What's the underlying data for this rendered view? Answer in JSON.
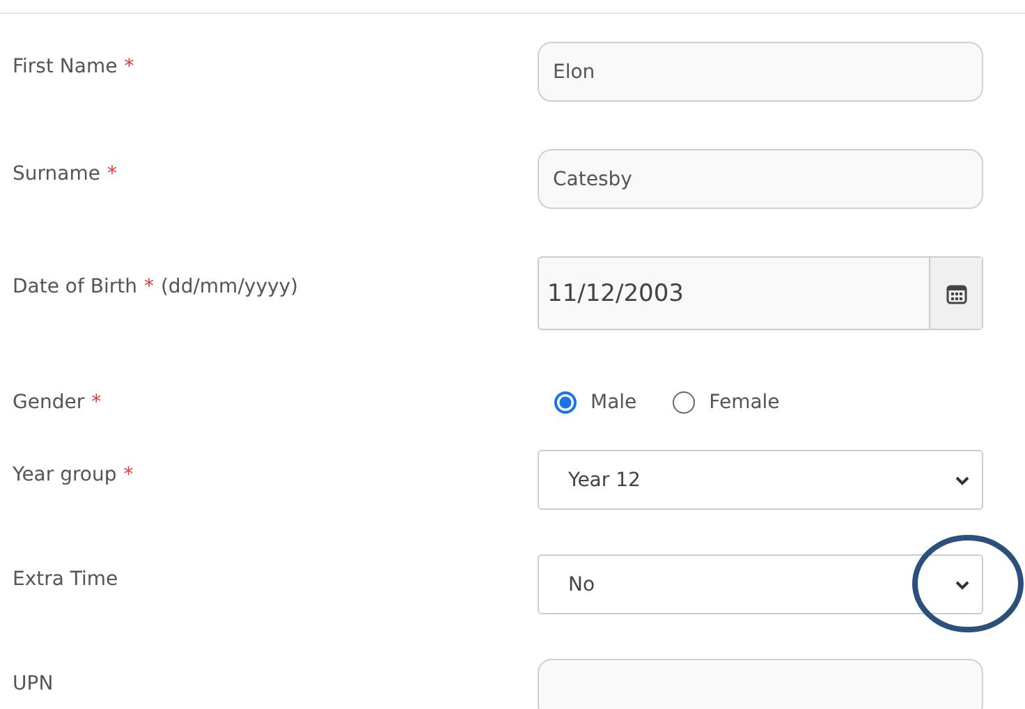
{
  "form": {
    "fields": [
      {
        "kind": "text",
        "label": "First Name",
        "asterisk": "*",
        "value": "Elon"
      },
      {
        "kind": "text",
        "label": "Surname",
        "asterisk": "*",
        "value": "Catesby"
      },
      {
        "kind": "date",
        "label": "Date of Birth",
        "asterisk": "*",
        "hint": "(dd/mm/yyyy)",
        "value": "11/12/2003"
      },
      {
        "kind": "radio",
        "label": "Gender",
        "asterisk": "*",
        "options": [
          {
            "label": "Male",
            "selected": true
          },
          {
            "label": "Female",
            "selected": false
          }
        ]
      },
      {
        "kind": "select",
        "label": "Year group",
        "asterisk": "*",
        "value": "Year 12",
        "highlighted": false
      },
      {
        "kind": "select",
        "label": "Extra Time",
        "value": "No",
        "highlighted": true
      },
      {
        "kind": "text",
        "label": "UPN"
      }
    ]
  }
}
